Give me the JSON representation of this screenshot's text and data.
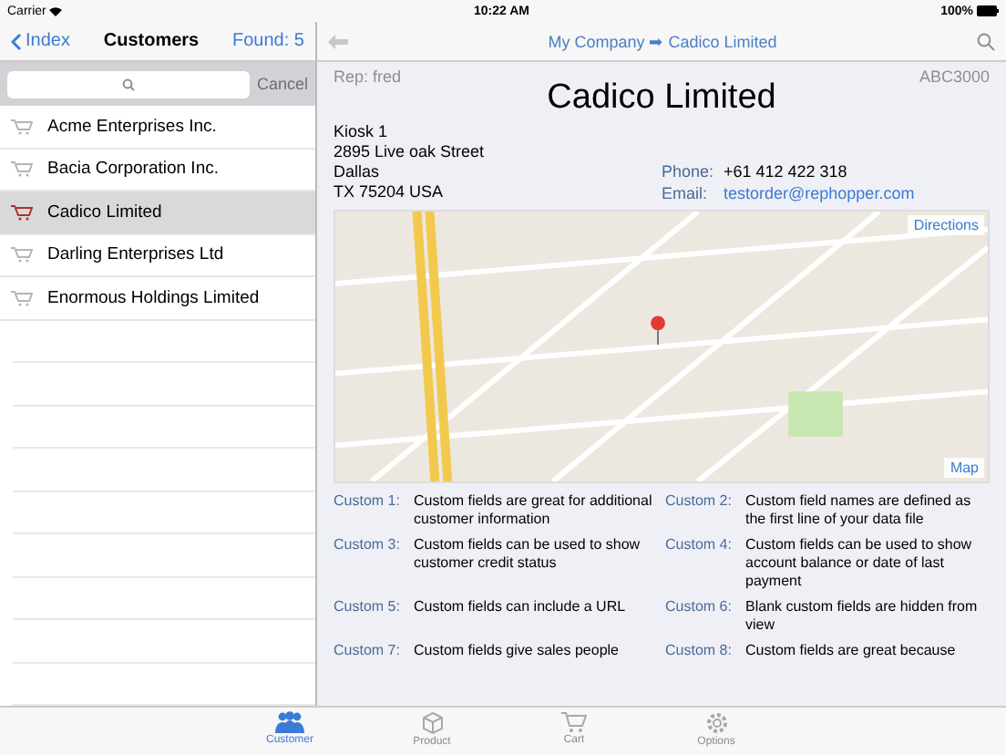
{
  "status_bar": {
    "carrier": "Carrier",
    "time": "10:22 AM",
    "battery": "100%"
  },
  "list_pane": {
    "back": "Index",
    "title": "Customers",
    "found": "Found: 5",
    "cancel": {
      "label": "Cancel",
      "disabled": true
    },
    "items": [
      {
        "name": "Acme Enterprises Inc.",
        "selected": false
      },
      {
        "name": "Bacia Corporation Inc.",
        "selected": false
      },
      {
        "name": "Cadico Limited",
        "selected": true
      },
      {
        "name": "Darling Enterprises Ltd",
        "selected": false
      },
      {
        "name": "Enormous Holdings Limited",
        "selected": false
      }
    ]
  },
  "detail": {
    "breadcrumb": {
      "parent": "My Company",
      "arrow": "➡",
      "current": "Cadico Limited"
    },
    "rep": "Rep: fred",
    "code": "ABC3000",
    "name": "Cadico Limited",
    "address": [
      "Kiosk 1",
      "2895 Live oak Street",
      "Dallas",
      "TX 75204 USA"
    ],
    "contacts": [
      {
        "label": "Phone:",
        "value": "+61 412 422 318",
        "kind": "text"
      },
      {
        "label": "Email:",
        "value": "testorder@rephopper.com",
        "kind": "link"
      }
    ],
    "map": {
      "directions": "Directions",
      "label": "Map"
    },
    "custom_fields": [
      {
        "label": "Custom 1:",
        "value": "Custom fields are great for additional customer information"
      },
      {
        "label": "Custom 2:",
        "value": "Custom field names are defined as the first line of your data file"
      },
      {
        "label": "Custom 3:",
        "value": "Custom fields can be used to show customer credit status"
      },
      {
        "label": "Custom 4:",
        "value": "Custom fields can be used to show account balance or date of last payment"
      },
      {
        "label": "Custom 5:",
        "value": "Custom fields can include a URL"
      },
      {
        "label": "Custom 6:",
        "value": "Blank custom fields are hidden from view"
      },
      {
        "label": "Custom 7:",
        "value": "Custom fields give sales people"
      },
      {
        "label": "Custom 8:",
        "value": "Custom fields are great because"
      }
    ]
  },
  "tab_bar": [
    {
      "label": "Customer",
      "kind": "people",
      "selected": true
    },
    {
      "label": "Product",
      "kind": "box",
      "selected": false
    },
    {
      "label": "Cart",
      "kind": "cart",
      "selected": false
    },
    {
      "label": "Options",
      "kind": "gear",
      "selected": false
    }
  ]
}
